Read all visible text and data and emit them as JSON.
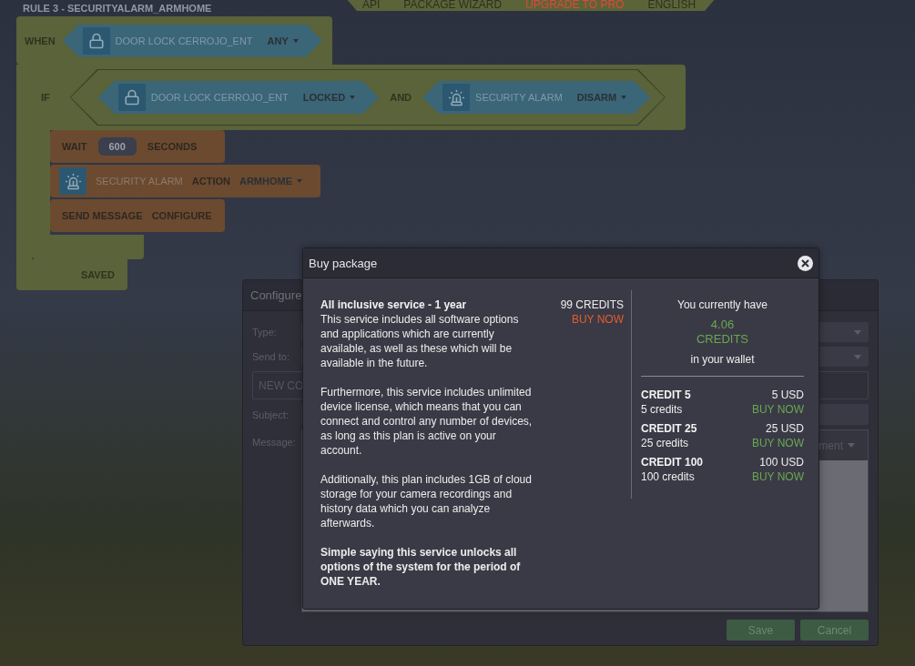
{
  "rule_title": "RULE 3 - SECURITYALARM_ARMHOME",
  "top_nav": [
    {
      "label": "API",
      "kind": "link"
    },
    {
      "label": "PACKAGE WIZARD",
      "kind": "link"
    },
    {
      "label": "UPGRADE TO PRO",
      "kind": "promo"
    },
    {
      "label": "ENGLISH",
      "kind": "link"
    }
  ],
  "when_block": {
    "label": "WHEN",
    "device": {
      "kind": "lock",
      "name": "DOOR LOCK CERROJO_ENT",
      "option": "ANY"
    }
  },
  "if_block": {
    "label": "IF",
    "joiner": "AND",
    "conditions": [
      {
        "kind": "lock",
        "name": "DOOR LOCK CERROJO_ENT",
        "option": "LOCKED"
      },
      {
        "kind": "alarm",
        "name": "SECURITY ALARM",
        "option": "DISARM"
      }
    ]
  },
  "actions": [
    {
      "kind": "wait",
      "label": "WAIT",
      "value": "600",
      "unit": "SECONDS"
    },
    {
      "kind": "device",
      "device": {
        "kind": "alarm",
        "name": "SECURITY ALARM"
      },
      "label": "ACTION",
      "option": "ARMHOME"
    },
    {
      "kind": "message",
      "label": "SEND MESSAGE",
      "value": "CONFIGURE"
    }
  ],
  "saved_label": "SAVED",
  "configure_dialog": {
    "title": "Configure",
    "type_label": "Type:",
    "send_to_label": "Send to:",
    "contact_value": "NEW CO",
    "subject_label": "Subject:",
    "message_label": "Message:",
    "editor_menu": "ment",
    "buttons": [
      "Save",
      "Cancel"
    ]
  },
  "buy_modal": {
    "title": "Buy package",
    "package": {
      "title": "All inclusive service - 1 year",
      "price": "99 CREDITS",
      "buy": "BUY NOW",
      "paragraphs": [
        {
          "kind": "text",
          "text": "This service includes all software options and applications which are currently available, as well as these which will be available in the future."
        },
        {
          "kind": "text",
          "text": "Furthermore, this service includes unlimited device license, which means that you can connect and control any number of devices, as long as this plan is active on your account."
        },
        {
          "kind": "text",
          "text": "Additionally, this plan includes 1GB of cloud storage for your camera recordings and history data which you can analyze afterwards."
        },
        {
          "kind": "note",
          "text": "Simple saying this service unlocks all options of the system for the period of ONE YEAR."
        }
      ]
    },
    "wallet": {
      "intro": "You currently have",
      "amount": "4.06",
      "unit": "CREDITS",
      "suffix": "in your wallet"
    },
    "credit_options": [
      {
        "name": "CREDIT 5",
        "count": "5 credits",
        "price": "5 USD",
        "buy": "BUY NOW"
      },
      {
        "name": "CREDIT 25",
        "count": "25 credits",
        "price": "25 USD",
        "buy": "BUY NOW"
      },
      {
        "name": "CREDIT 100",
        "count": "100 credits",
        "price": "100 USD",
        "buy": "BUY NOW"
      }
    ]
  }
}
